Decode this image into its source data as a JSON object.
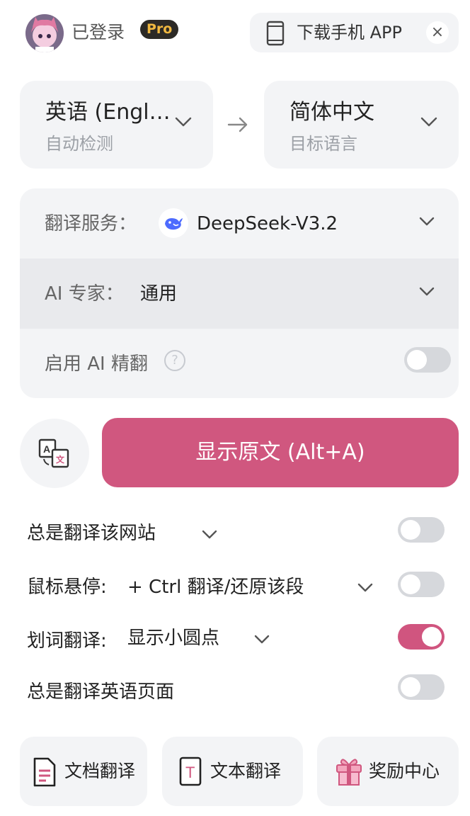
{
  "header": {
    "login_status": "已登录",
    "pro_badge": "Pro",
    "download_app": "下载手机 APP",
    "close_symbol": "×"
  },
  "languages": {
    "source_name": "英语 (Engl…",
    "source_sub": "自动检测",
    "target_name": "简体中文",
    "target_sub": "目标语言"
  },
  "service_card": {
    "service_label": "翻译服务：",
    "service_value": "DeepSeek-V3.2",
    "expert_label": "AI 专家：",
    "expert_value": "通用",
    "ai_refine_label": "启用 AI 精翻",
    "ai_refine_enabled": false,
    "help_symbol": "?"
  },
  "actions": {
    "show_original_button": "显示原文 (Alt+A)"
  },
  "options": {
    "always_translate_site_label": "总是翻译该网站",
    "always_translate_site_enabled": false,
    "hover_label": "鼠标悬停:",
    "hover_value": "+ Ctrl 翻译/还原该段",
    "hover_enabled": false,
    "selection_label": "划词翻译:",
    "selection_value": "显示小圆点",
    "selection_enabled": true,
    "always_translate_english_label": "总是翻译英语页面",
    "always_translate_english_enabled": false
  },
  "bottom_buttons": {
    "doc_translate": "文档翻译",
    "text_translate": "文本翻译",
    "reward_center": "奖励中心",
    "text_icon_letter": "T"
  },
  "colors": {
    "accent": "#d0577f",
    "card_bg": "#f3f4f6",
    "toggle_off": "#d6d8dc",
    "pro_badge_bg": "#2c2a26",
    "pro_badge_text": "#f0b840",
    "deepseek_blue": "#4d6bfe"
  },
  "icons": [
    "avatar",
    "phone-icon",
    "close-icon",
    "chevron-down-icon",
    "arrow-right-icon",
    "deepseek-icon",
    "help-icon",
    "translate-swap-icon",
    "document-icon",
    "text-icon",
    "gift-icon"
  ]
}
